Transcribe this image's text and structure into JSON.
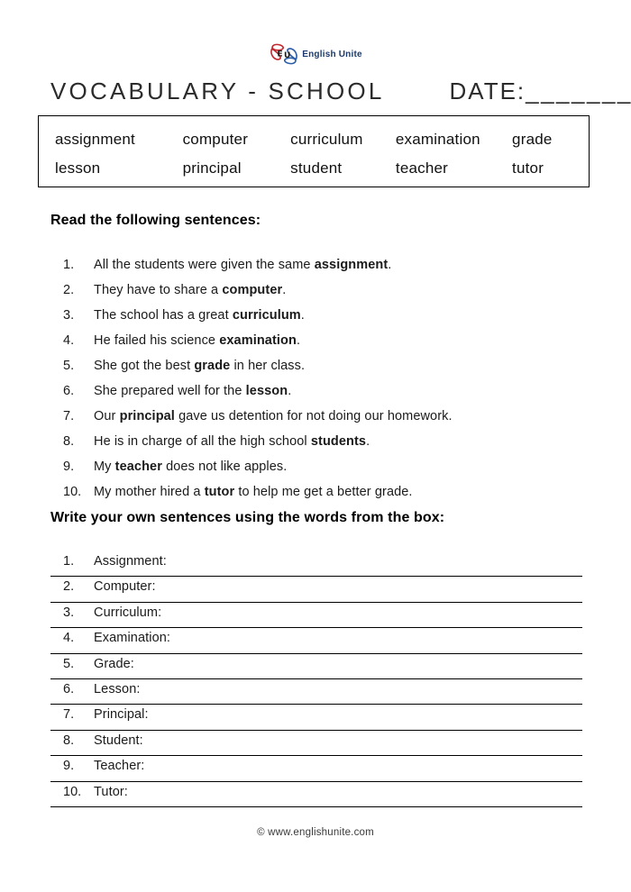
{
  "logo": {
    "icon": "english-unite-logo-icon",
    "text": "English Unite",
    "colors": {
      "red": "#c0272d",
      "blue": "#2b5ca8",
      "text": "#1b3a6b"
    }
  },
  "title": {
    "main": "VOCABULARY - SCHOOL",
    "date_label": "DATE:",
    "date_line": "________"
  },
  "word_box": {
    "rows": [
      [
        "assignment",
        "computer",
        "curriculum",
        "examination",
        "grade"
      ],
      [
        "lesson",
        "principal",
        "student",
        "teacher",
        "tutor"
      ]
    ]
  },
  "sections": {
    "read_heading": "Read the following sentences:",
    "write_heading": "Write your own sentences using the words from the box:"
  },
  "sentences": [
    {
      "num": "1.",
      "before": "All the students were given the same ",
      "bold": "assignment",
      "after": "."
    },
    {
      "num": "2.",
      "before": "They have to share a ",
      "bold": "computer",
      "after": "."
    },
    {
      "num": "3.",
      "before": "The school has a great ",
      "bold": "curriculum",
      "after": "."
    },
    {
      "num": "4.",
      "before": "He failed his science ",
      "bold": "examination",
      "after": "."
    },
    {
      "num": "5.",
      "before": "She got the best ",
      "bold": "grade",
      "after": " in her class."
    },
    {
      "num": "6.",
      "before": "She prepared well for the ",
      "bold": "lesson",
      "after": "."
    },
    {
      "num": "7.",
      "before": "Our ",
      "bold": "principal",
      "after": " gave us detention for not doing our homework."
    },
    {
      "num": "8.",
      "before": "He is in charge of all the high school ",
      "bold": "students",
      "after": "."
    },
    {
      "num": "9.",
      "before": "My ",
      "bold": "teacher",
      "after": " does not like apples."
    },
    {
      "num": "10.",
      "before": "My mother hired a ",
      "bold": "tutor",
      "after": " to help me get a better grade."
    }
  ],
  "write_lines": [
    {
      "num": "1.",
      "label": "Assignment:"
    },
    {
      "num": "2.",
      "label": "Computer:"
    },
    {
      "num": "3.",
      "label": "Curriculum:"
    },
    {
      "num": "4.",
      "label": "Examination:"
    },
    {
      "num": "5.",
      "label": "Grade:"
    },
    {
      "num": "6.",
      "label": "Lesson:"
    },
    {
      "num": "7.",
      "label": "Principal:"
    },
    {
      "num": "8.",
      "label": "Student:"
    },
    {
      "num": "9.",
      "label": "Teacher:"
    },
    {
      "num": "10.",
      "label": "Tutor:"
    }
  ],
  "footer": {
    "text": "© www.englishunite.com"
  }
}
